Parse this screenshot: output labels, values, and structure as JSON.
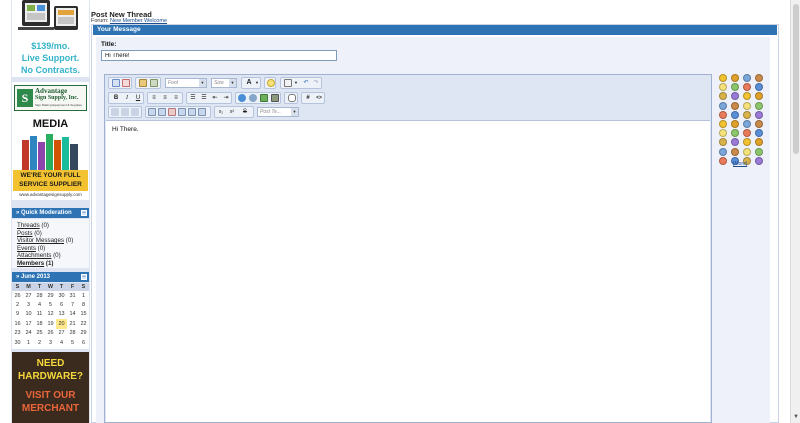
{
  "page": {
    "title": "Post New Thread",
    "forum_label": "Forum:",
    "forum_name": "New Member Welcome"
  },
  "sidebar": {
    "ad_top": {
      "price": "$139/mo.",
      "line2": "Live Support.",
      "line3": "No Contracts."
    },
    "ad_media": {
      "company_line1": "Advantage",
      "company_line2": "Sign Supply, Inc.",
      "company_tagline": "Sign Making Equipment & Supplies",
      "media": "MEDIA",
      "banner_line1": "WE'RE YOUR FULL",
      "banner_line2": "SERVICE SUPPLIER",
      "site": "www.advantagesignsupply.com"
    },
    "quick_moderation": {
      "title": "» Quick Moderation",
      "items": [
        {
          "label": "Threads",
          "count": " (0)"
        },
        {
          "label": "Posts",
          "count": " (0)"
        },
        {
          "label": "Visitor Messages",
          "count": " (0)"
        },
        {
          "label": "Events",
          "count": " (0)"
        },
        {
          "label": "Attachments",
          "count": " (0)"
        },
        {
          "label": "Members",
          "count": " (1)"
        }
      ]
    },
    "calendar": {
      "title": "» June 2013",
      "dow": [
        "S",
        "M",
        "T",
        "W",
        "T",
        "F",
        "S"
      ],
      "weeks": [
        [
          "26",
          "27",
          "28",
          "29",
          "30",
          "31",
          "1"
        ],
        [
          "2",
          "3",
          "4",
          "5",
          "6",
          "7",
          "8"
        ],
        [
          "9",
          "10",
          "11",
          "12",
          "13",
          "14",
          "15"
        ],
        [
          "16",
          "17",
          "18",
          "19",
          "20",
          "21",
          "22"
        ],
        [
          "23",
          "24",
          "25",
          "26",
          "27",
          "28",
          "29"
        ],
        [
          "30",
          "1",
          "2",
          "3",
          "4",
          "5",
          "6"
        ]
      ],
      "today": "20"
    },
    "ad_hw": {
      "line1": "NEED",
      "line2": "HARDWARE?",
      "line3": "VISIT OUR",
      "line4": "MERCHANT"
    }
  },
  "panel": {
    "header": "Your Message",
    "title_label": "Title:",
    "title_value": "Hi There!"
  },
  "editor": {
    "font_placeholder": "Font",
    "size_placeholder": "Size",
    "font_color_label": "A",
    "bold": "B",
    "italic": "I",
    "underline": "U",
    "post_template_placeholder": "Post Te...",
    "link_label": "#",
    "code_label": "",
    "subscript": "x₂",
    "superscript": "x²",
    "body_text": "Hi There."
  },
  "smilies": {
    "more_label": "[More]"
  },
  "colors": {
    "accent": "#2e74b5",
    "panel_bg": "#eef1f9",
    "sidebar_bg": "#dfe4f3",
    "today": "#ffe88a"
  }
}
